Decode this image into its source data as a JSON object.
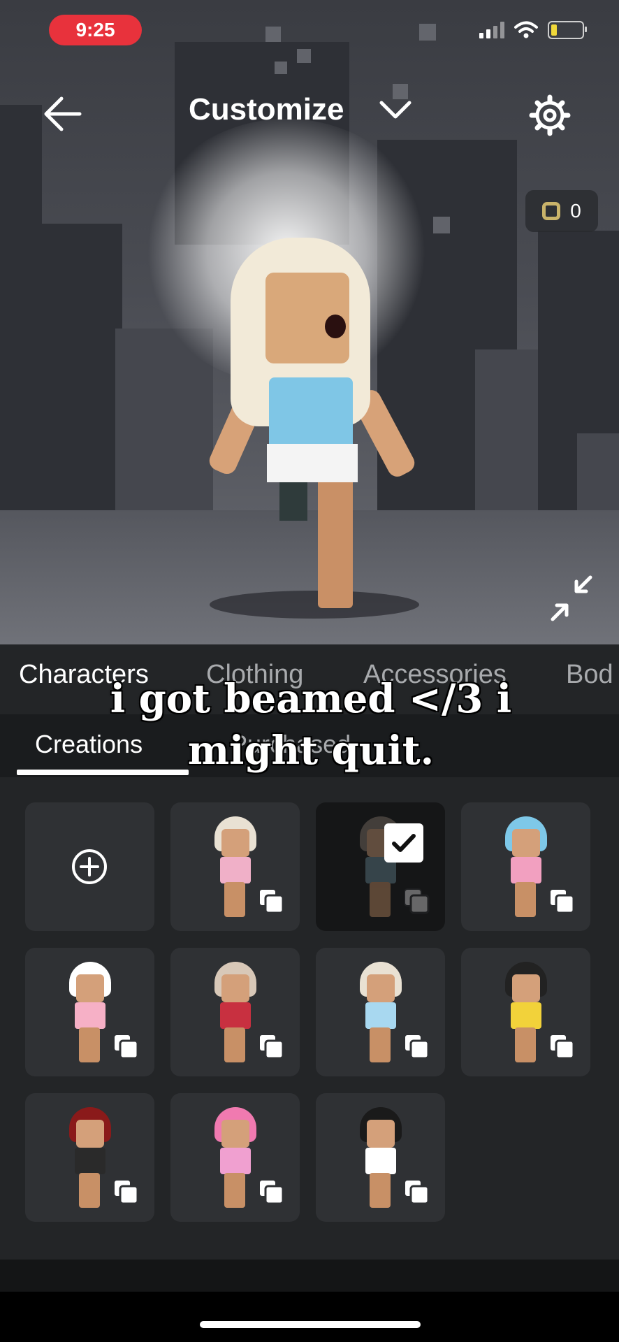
{
  "status": {
    "time": "9:25"
  },
  "header": {
    "title": "Customize",
    "robux_balance": "0"
  },
  "tabs": [
    "Characters",
    "Clothing",
    "Accessories",
    "Bod"
  ],
  "subtabs": [
    "Creations",
    "Purchased"
  ],
  "caption": [
    "i got beamed </3 i",
    "might quit."
  ],
  "grid": {
    "cards": [
      {
        "kind": "add",
        "icon": "plus-circle-icon"
      },
      {
        "kind": "character",
        "hair": "#e9e1d3",
        "body": "#f0b0c8"
      },
      {
        "kind": "character",
        "hair": "#8a7a70",
        "body": "#6a8b9a",
        "selected": true
      },
      {
        "kind": "character",
        "hair": "#7ec8e8",
        "body": "#f2a0c0"
      },
      {
        "kind": "character",
        "hair": "#ffffff",
        "body": "#f6b0c6"
      },
      {
        "kind": "character",
        "hair": "#d8c8b8",
        "body": "#c83040"
      },
      {
        "kind": "character",
        "hair": "#e9e1d3",
        "body": "#a8d8f0"
      },
      {
        "kind": "character",
        "hair": "#222222",
        "body": "#f2d23a"
      },
      {
        "kind": "character",
        "hair": "#8a1a1a",
        "body": "#2a2a2a"
      },
      {
        "kind": "character",
        "hair": "#f07ab0",
        "body": "#f0a0d0"
      },
      {
        "kind": "character",
        "hair": "#1a1a1a",
        "body": "#ffffff"
      }
    ]
  },
  "colors": {
    "status_pill": "#e8323c",
    "battery_fill": "#f0d83a",
    "robux": "#c9b36a"
  }
}
